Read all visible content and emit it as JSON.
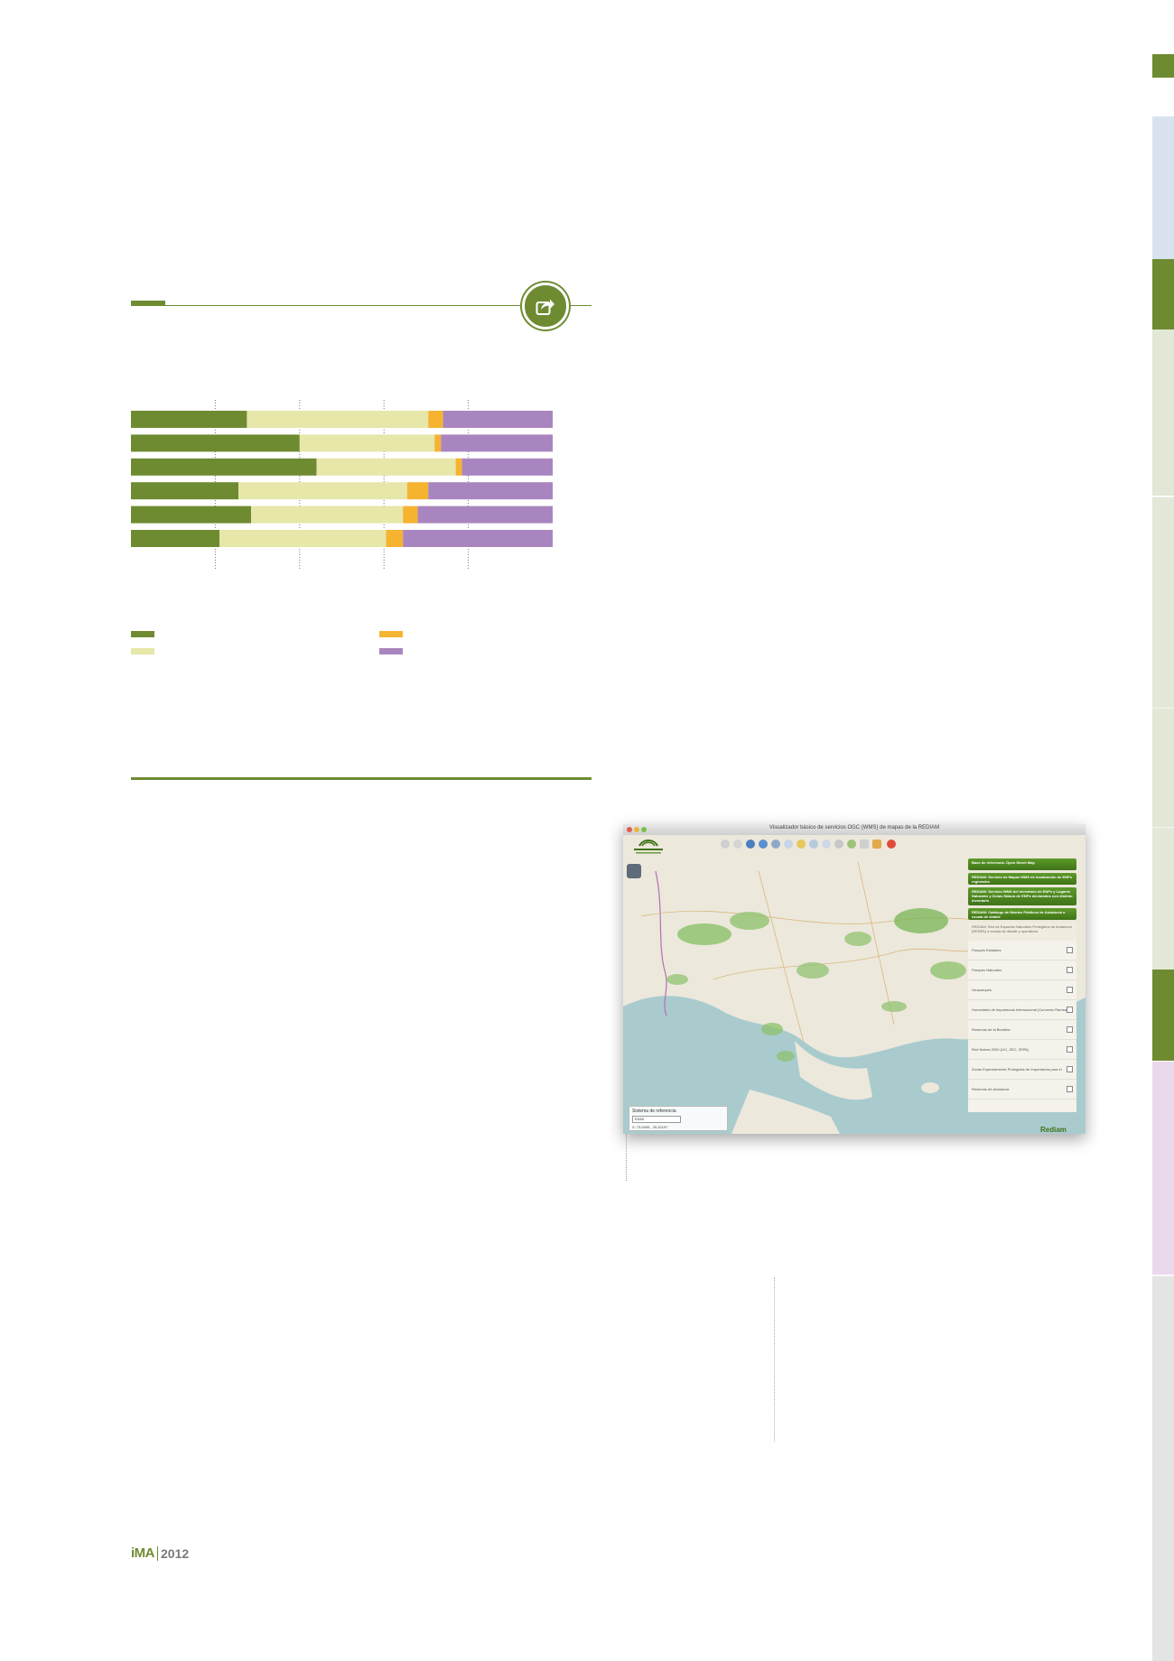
{
  "colors": {
    "accent": "#6f8b32",
    "light_green": "#e6e7a8",
    "orange": "#f5b330",
    "purple": "#a985bf"
  },
  "icons": {
    "share": "share-arrow-icon"
  },
  "chart_data": {
    "type": "bar",
    "orientation": "horizontal",
    "stacked": true,
    "categories": [
      "",
      "",
      "",
      "",
      "",
      ""
    ],
    "series": [
      {
        "color": "#6f8b32",
        "values": [
          27.5,
          40,
          44,
          25.5,
          28.5,
          21
        ]
      },
      {
        "color": "#e6e7a8",
        "values": [
          43,
          32,
          33,
          40,
          36,
          39.5
        ]
      },
      {
        "color": "#f5b330",
        "values": [
          3.5,
          1.5,
          1.5,
          5,
          3.5,
          4
        ]
      },
      {
        "color": "#a985bf",
        "values": [
          26,
          26.5,
          21.5,
          29.5,
          32,
          35.5
        ]
      }
    ],
    "xlim": [
      0,
      100
    ],
    "gridlines": [
      20,
      40,
      60,
      80
    ],
    "legend": "bottom"
  },
  "map_window": {
    "title": "Visualizador básico de servicios OGC (WMS) de mapas de la REDIAM",
    "layers_header": [
      "Base de referencia: Open Street Map",
      "REDIAM: Servicio de Mapas WMS de localización de ENPs regionales",
      "REDIAM: Servicio WMS del Inventario de ENPs y Lugares Naturales y Zonas Natura de ENPs declarados con distinto inventario",
      "REDIAM: Catálogo de Montes Públicos de Andalucía o escala de detalle"
    ],
    "layers_sub": "REDIAM: Red de Espacios Naturales Protegidos de Andalucía (RENPA) a escala de detalle y operativos",
    "layers": [
      "Parques Estatales",
      "Parques Naturales",
      "Geoparques",
      "Humedales de Importancia Internacional (Convenio Ramsar)",
      "Reservas de la Biosfera",
      "Red Natura 2000 (LIC, ZEC, ZEPA)",
      "Zonas Especialmente Protegidas de Importancia para el Mediterráneo (ZEPIM) Andalucía",
      "Reservas de Andalucía"
    ],
    "reference_label": "Sistema de referencia",
    "reference_value": "ED50",
    "coordinates": "X: 73.0006 , 25.32197",
    "brand": "Rediam"
  },
  "footer": {
    "ima": "iMA",
    "year": "2012"
  }
}
